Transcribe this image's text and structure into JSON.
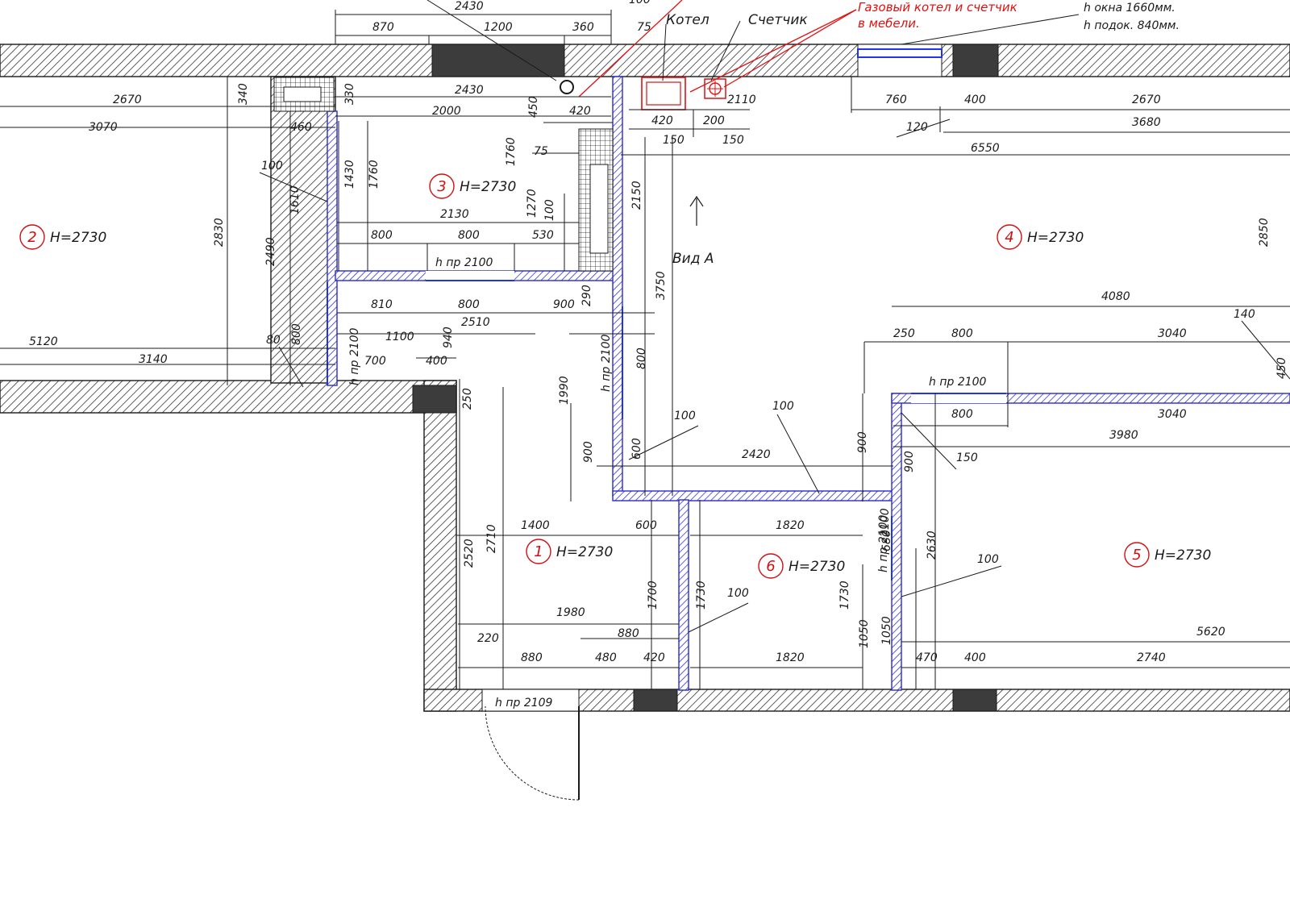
{
  "rooms": [
    {
      "num": "1",
      "height": "H=2730"
    },
    {
      "num": "2",
      "height": "H=2730"
    },
    {
      "num": "3",
      "height": "H=2730"
    },
    {
      "num": "4",
      "height": "H=2730"
    },
    {
      "num": "5",
      "height": "H=2730"
    },
    {
      "num": "6",
      "height": "H=2730"
    }
  ],
  "labels": {
    "boiler": "Котел",
    "meter": "Счетчик",
    "gas_note_1": "Газовый котел и счетчик",
    "gas_note_2": "в мебели.",
    "window_h": "h окна 1660мм.",
    "sill_h": "h подок. 840мм.",
    "view_a": "Вид А",
    "door_h_2100": "h пр 2100",
    "door_h_2109": "h пр 2109"
  },
  "dims": {
    "d2430a": "2430",
    "d870": "870",
    "d1200a": "1200",
    "d360": "360",
    "d75a": "75",
    "d100top": "100",
    "d2670a": "2670",
    "d3070": "3070",
    "d340": "340",
    "d330": "330",
    "d460": "460",
    "d2430b": "2430",
    "d2000": "2000",
    "d450": "450",
    "d420a": "420",
    "d420b": "420",
    "d200": "200",
    "d2110": "2110",
    "d150a": "150",
    "d150b": "150",
    "d760": "760",
    "d400a": "400",
    "d2670b": "2670",
    "d120": "120",
    "d3680": "3680",
    "d6550": "6550",
    "d100a": "100",
    "d1610": "1610",
    "d1430": "1430",
    "d1760a": "1760",
    "d1760b": "1760",
    "d75b": "75",
    "d1270": "1270",
    "d100b": "100",
    "d2150": "2150",
    "d2830": "2830",
    "d2490": "2490",
    "d2130": "2130",
    "d800a": "800",
    "d800b": "800",
    "d530": "530",
    "d2850": "2850",
    "d810": "810",
    "d800c": "800",
    "d900a": "900",
    "d290": "290",
    "d2510": "2510",
    "d3750": "3750",
    "d4080": "4080",
    "d140": "140",
    "d5120": "5120",
    "d80": "80",
    "d800d": "800",
    "d1100": "1100",
    "d940": "940",
    "d3140": "3140",
    "d700": "700",
    "d400b": "400",
    "d250a": "250",
    "d800e": "800",
    "d3040a": "3040",
    "d450b": "450",
    "d800f": "800",
    "d250b": "250",
    "d1990": "1990",
    "d100c": "100",
    "d100d": "100",
    "d800g": "800",
    "d3040b": "3040",
    "d3980": "3980",
    "d150c": "150",
    "d900b": "900",
    "d600a": "600",
    "d2420": "2420",
    "d900c": "900",
    "d900d": "900",
    "d1400": "1400",
    "d600b": "600",
    "d1820a": "1820",
    "d2100v": "2100",
    "d2520": "2520",
    "d2710": "2710",
    "d1700": "1700",
    "d1730a": "1730",
    "d100e": "100",
    "d680": "680",
    "d2630": "2630",
    "d100f": "100",
    "d1730b": "1730",
    "d1980": "1980",
    "d880a": "880",
    "d220": "220",
    "d880b": "880",
    "d480": "480",
    "d420c": "420",
    "d1820b": "1820",
    "d1050a": "1050",
    "d1050b": "1050",
    "d470": "470",
    "d400c": "400",
    "d2740": "2740",
    "d5620": "5620"
  }
}
